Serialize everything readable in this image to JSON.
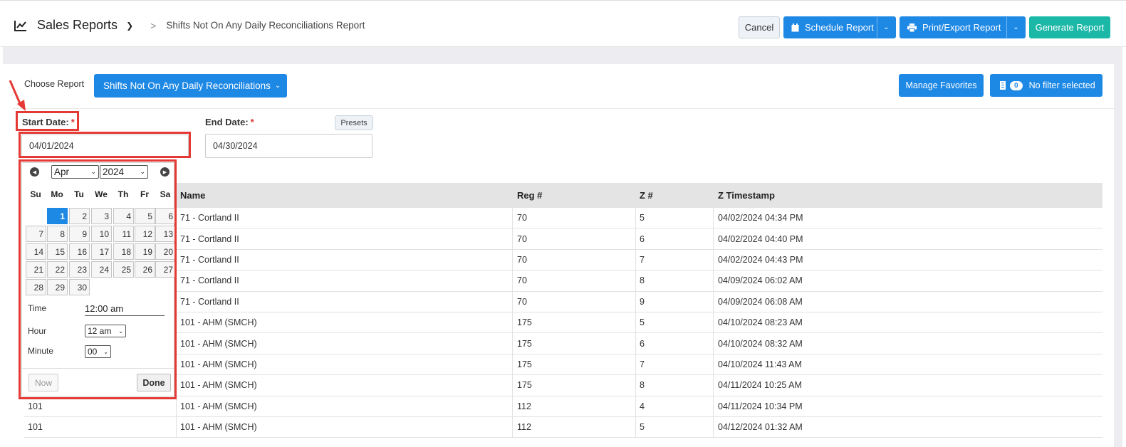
{
  "header": {
    "app_title": "Sales Reports",
    "breadcrumb_sep": ">",
    "breadcrumb": "Shifts Not On Any Daily Reconciliations Report",
    "cancel_label": "Cancel",
    "schedule_label": "Schedule Report",
    "print_label": "Print/Export Report",
    "generate_label": "Generate Report"
  },
  "filters": {
    "choose_report_label": "Choose Report",
    "report_selected": "Shifts Not On Any Daily Reconciliations",
    "manage_favorites_label": "Manage Favorites",
    "filter_count": "0",
    "filter_status": "No filter selected",
    "start_date_label": "Start Date:",
    "start_date_value": "04/01/2024",
    "end_date_label": "End Date:",
    "end_date_value": "04/30/2024",
    "required_marker": "*",
    "presets_label": "Presets"
  },
  "datepicker": {
    "month": "Apr",
    "year": "2024",
    "weekdays": [
      "Su",
      "Mo",
      "Tu",
      "We",
      "Th",
      "Fr",
      "Sa"
    ],
    "selected_day": "1",
    "time_label": "Time",
    "time_value": "12:00 am",
    "hour_label": "Hour",
    "hour_value": "12 am",
    "minute_label": "Minute",
    "minute_value": "00",
    "now_label": "Now",
    "done_label": "Done",
    "days": [
      "1",
      "2",
      "3",
      "4",
      "5",
      "6",
      "7",
      "8",
      "9",
      "10",
      "11",
      "12",
      "13",
      "14",
      "15",
      "16",
      "17",
      "18",
      "19",
      "20",
      "21",
      "22",
      "23",
      "24",
      "25",
      "26",
      "27",
      "28",
      "29",
      "30"
    ]
  },
  "table": {
    "columns": [
      "",
      "Name",
      "Reg #",
      "Z #",
      "Z Timestamp"
    ],
    "rows": [
      [
        "",
        "71 - Cortland II",
        "70",
        "5",
        "04/02/2024 04:34 PM"
      ],
      [
        "",
        "71 - Cortland II",
        "70",
        "6",
        "04/02/2024 04:40 PM"
      ],
      [
        "",
        "71 - Cortland II",
        "70",
        "7",
        "04/02/2024 04:43 PM"
      ],
      [
        "",
        "71 - Cortland II",
        "70",
        "8",
        "04/09/2024 06:02 AM"
      ],
      [
        "",
        "71 - Cortland II",
        "70",
        "9",
        "04/09/2024 06:08 AM"
      ],
      [
        "",
        "101 - AHM (SMCH)",
        "175",
        "5",
        "04/10/2024 08:23 AM"
      ],
      [
        "",
        "101 - AHM (SMCH)",
        "175",
        "6",
        "04/10/2024 08:32 AM"
      ],
      [
        "",
        "101 - AHM (SMCH)",
        "175",
        "7",
        "04/10/2024 11:43 AM"
      ],
      [
        "",
        "101 - AHM (SMCH)",
        "175",
        "8",
        "04/11/2024 10:25 AM"
      ],
      [
        "101",
        "101 - AHM (SMCH)",
        "112",
        "4",
        "04/11/2024 10:34 PM"
      ],
      [
        "101",
        "101 - AHM (SMCH)",
        "112",
        "5",
        "04/12/2024 01:32 AM"
      ]
    ]
  },
  "colors": {
    "primary": "#1e88e5",
    "teal": "#1bb8a8",
    "highlight": "#e53935"
  }
}
